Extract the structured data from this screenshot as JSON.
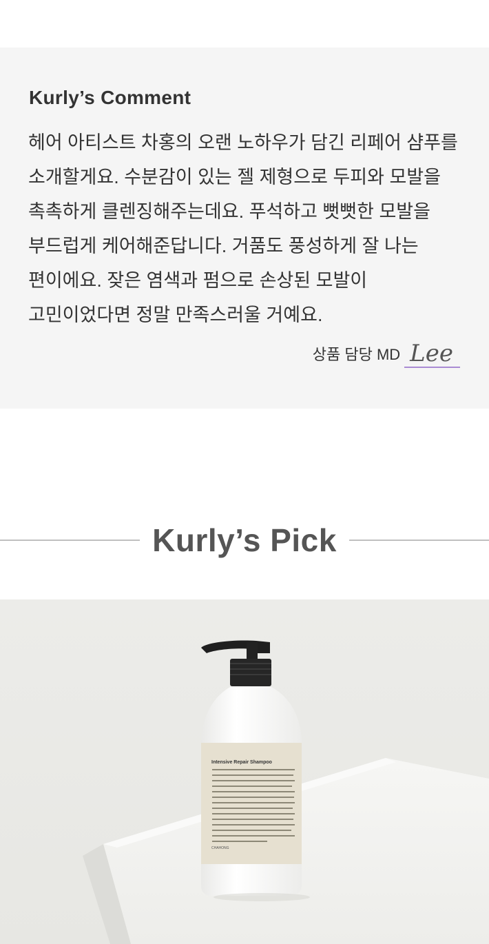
{
  "comment": {
    "title": "Kurly’s Comment",
    "body": "헤어 아티스트 차홍의 오랜 노하우가 담긴 리페어 샴푸를 소개할게요. 수분감이 있는 젤 제형으로 두피와 모발을 촉촉하게 클렌징해주는데요. 푸석하고 뻣뻣한 모발을 부드럽게 케어해준답니다. 거품도 풍성하게 잘 나는 편이에요. 잦은 염색과 펌으로 손상된 모발이 고민이었다면 정말 만족스러울 거예요.",
    "md_label": "상품 담당 MD",
    "md_name": "Lee"
  },
  "pick": {
    "title": "Kurly’s Pick"
  },
  "product": {
    "label_title": "Intensive Repair Shampoo",
    "brand": "CHAHONG"
  }
}
